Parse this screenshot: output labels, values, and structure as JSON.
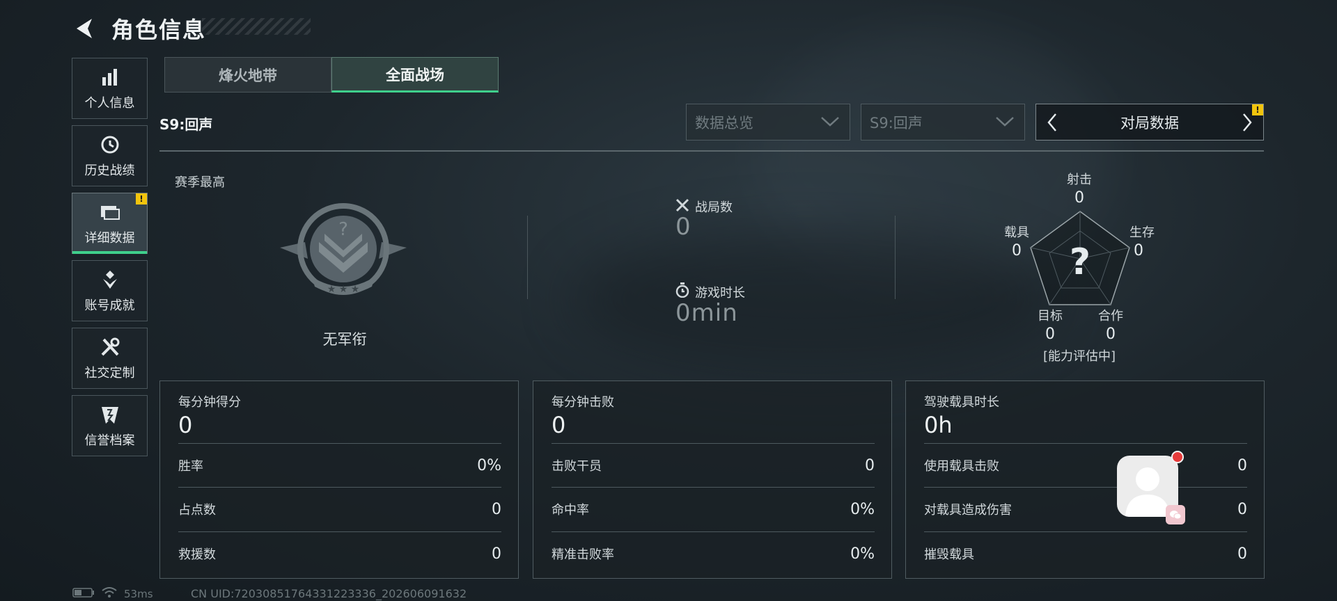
{
  "header": {
    "title": "角色信息"
  },
  "sidebar": {
    "items": [
      {
        "label": "个人信息",
        "icon": "bar-chart-icon"
      },
      {
        "label": "历史战绩",
        "icon": "history-clock-icon"
      },
      {
        "label": "详细数据",
        "icon": "folder-icon",
        "active": true,
        "badge": "!"
      },
      {
        "label": "账号成就",
        "icon": "achievement-icon"
      },
      {
        "label": "社交定制",
        "icon": "tools-icon"
      },
      {
        "label": "信誉档案",
        "icon": "credit-shield-icon"
      }
    ]
  },
  "tabs": [
    {
      "label": "烽火地带",
      "active": false
    },
    {
      "label": "全面战场",
      "active": true
    }
  ],
  "season": {
    "label": "S9:回声"
  },
  "filters": {
    "overview": "数据总览",
    "season": "S9:回声",
    "match_data": "对局数据",
    "match_badge": "!"
  },
  "season_best": {
    "label": "赛季最高",
    "rank_name": "无军衔"
  },
  "stats": {
    "matches_label": "战局数",
    "matches_value": "0",
    "time_label": "游戏时长",
    "time_value": "0min"
  },
  "radar": {
    "status": "[能力评估中]",
    "axes": [
      {
        "label": "射击",
        "value": "0"
      },
      {
        "label": "生存",
        "value": "0"
      },
      {
        "label": "合作",
        "value": "0"
      },
      {
        "label": "目标",
        "value": "0"
      },
      {
        "label": "载具",
        "value": "0"
      }
    ]
  },
  "panels": [
    {
      "title": "每分钟得分",
      "value": "0",
      "rows": [
        {
          "label": "胜率",
          "value": "0%"
        },
        {
          "label": "占点数",
          "value": "0"
        },
        {
          "label": "救援数",
          "value": "0"
        }
      ]
    },
    {
      "title": "每分钟击败",
      "value": "0",
      "rows": [
        {
          "label": "击败干员",
          "value": "0"
        },
        {
          "label": "命中率",
          "value": "0%"
        },
        {
          "label": "精准击败率",
          "value": "0%"
        }
      ]
    },
    {
      "title": "驾驶载具时长",
      "value": "0h",
      "rows": [
        {
          "label": "使用载具击败",
          "value": "0"
        },
        {
          "label": "对载具造成伤害",
          "value": "0"
        },
        {
          "label": "摧毁载具",
          "value": "0"
        }
      ]
    }
  ],
  "status_bar": {
    "ping": "53ms",
    "uid": "CN UID:72030851764331223336_202606091632"
  },
  "colors": {
    "accent": "#3fd08c",
    "warning": "#f2c40d",
    "notify": "#e63b3b"
  }
}
